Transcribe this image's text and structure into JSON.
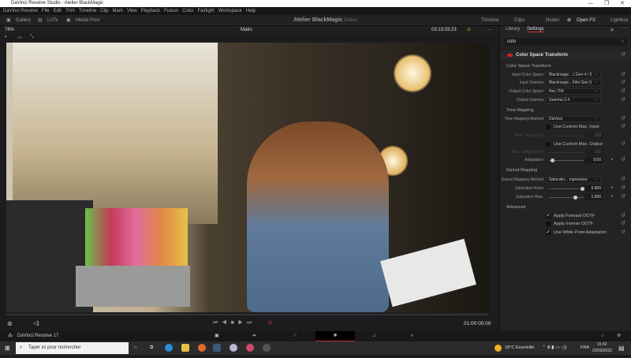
{
  "window": {
    "title": "DaVinci Resolve Studio - Atelier BlackMagic",
    "min": "—",
    "max": "❐",
    "close": "✕"
  },
  "menu": [
    "DaVinci Resolve",
    "File",
    "Edit",
    "Trim",
    "Timeline",
    "Clip",
    "Mark",
    "View",
    "Playback",
    "Fusion",
    "Color",
    "Fairlight",
    "Workspace",
    "Help"
  ],
  "toolbar": {
    "gallery": "Gallery",
    "luts": "LUTs",
    "media_pool": "Media Pool",
    "project": "Atelier BlackMagic",
    "status": "Edited",
    "timeline": "Timeline",
    "clips": "Clips",
    "nodes": "Nodes",
    "openfx": "Open FX",
    "lightbox": "Lightbox"
  },
  "viewer": {
    "zoom": "76%",
    "clip_name": "Matin",
    "timecode": "03:13:03:23",
    "playhead_tc": "01:00:00:00"
  },
  "panel": {
    "tab_library": "Library",
    "tab_settings": "Settings",
    "search_value": "colo",
    "effect": "Color Space Transform",
    "sections": {
      "cst": "Color Space Transform",
      "tone": "Tone Mapping",
      "gamut": "Gamut Mapping",
      "advanced": "Advanced"
    },
    "fields": {
      "input_cs": {
        "label": "Input Color Space",
        "value": "Blackmagic ...t Gen 4 / 5"
      },
      "input_gamma": {
        "label": "Input Gamma",
        "value": "Blackmagic...Film Gen 5"
      },
      "output_cs": {
        "label": "Output Color Space",
        "value": "Rec.709"
      },
      "output_gamma": {
        "label": "Output Gamma",
        "value": "Gamma 2.4"
      },
      "tm_method": {
        "label": "Tone Mapping Method",
        "value": "DaVinci"
      },
      "custom_in": {
        "label": "Use Custom Max. Input"
      },
      "max_in": {
        "label": "Max. Input (nits)",
        "value": "100"
      },
      "custom_out": {
        "label": "Use Custom Max. Output"
      },
      "max_out": {
        "label": "Max. Output (nits)",
        "value": "100"
      },
      "adaptation": {
        "label": "Adaptation",
        "value": "9.00",
        "fraction": 0.05
      },
      "gm_method": {
        "label": "Gamut Mapping Method",
        "value": "Saturatio... mpression"
      },
      "sat_knee": {
        "label": "Saturation Knee",
        "value": "0.900",
        "fraction": 0.9
      },
      "sat_max": {
        "label": "Saturation Max.",
        "value": "1.000",
        "fraction": 0.7
      },
      "fwd_ootf": {
        "label": "Apply Forward OOTF",
        "checked": true
      },
      "inv_ootf": {
        "label": "Apply Inverse OOTF",
        "checked": false
      },
      "wpa": {
        "label": "Use White Point Adaptation",
        "checked": true
      }
    }
  },
  "pagebar": {
    "app": "DaVinci Resolve 17"
  },
  "taskbar": {
    "search_placeholder": "Taper ici pour rechercher",
    "weather": "18°C  Ensoleillé",
    "lang": "FRA",
    "time": "16:42",
    "date": "23/03/2022"
  }
}
